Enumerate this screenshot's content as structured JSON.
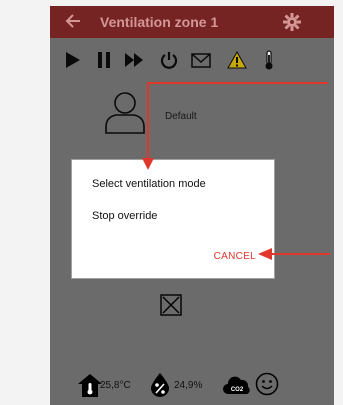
{
  "app": {
    "title": "Ventilation zone 1"
  },
  "profile": {
    "label": "Default"
  },
  "dialog": {
    "options": [
      "Select ventilation mode",
      "Stop override"
    ],
    "cancel_label": "CANCEL"
  },
  "status": {
    "temperature": "25,8°C",
    "humidity": "24,9%",
    "co2_label": "CO2"
  },
  "colors": {
    "topbar": "#7a1d1d",
    "background": "#6f6f6f",
    "dialog": "#ffffff",
    "cancel": "#e0362c",
    "annotation": "#e0362c"
  },
  "icons": {
    "back": "back-arrow-icon",
    "settings": "gear-icon",
    "play": "play-icon",
    "pause": "pause-icon",
    "fast_forward": "fast-forward-icon",
    "power": "power-icon",
    "mail": "mail-icon",
    "warning": "warning-icon",
    "thermometer": "thermometer-icon",
    "profile": "user-icon",
    "close": "close-box-icon",
    "home": "home-temperature-icon",
    "humidity": "humidity-icon",
    "co2": "co2-cloud-icon",
    "smiley": "smiley-icon"
  }
}
